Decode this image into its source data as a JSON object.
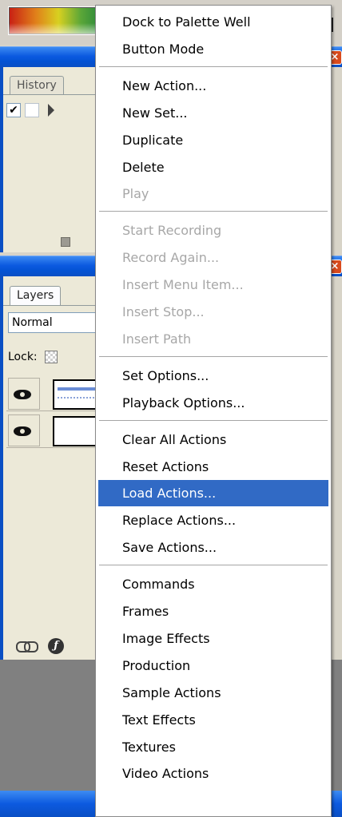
{
  "background": {
    "history_panel": {
      "tab_label": "History",
      "check_mark": "✔"
    },
    "layers_panel": {
      "tab_label": "Layers",
      "blend_mode": "Normal",
      "lock_label": "Lock:"
    },
    "icons": [
      "link-icon",
      "fx-icon",
      "eye-icon",
      "close-icon",
      "stop-icon"
    ],
    "accent_colors": {
      "titlebar": "#0a4fc4",
      "highlight": "#316ac5",
      "close_button": "#d84b1e"
    }
  },
  "menu": {
    "groups": [
      {
        "items": [
          {
            "label": "Dock to Palette Well",
            "enabled": true
          },
          {
            "label": "Button Mode",
            "enabled": true
          }
        ]
      },
      {
        "items": [
          {
            "label": "New Action...",
            "enabled": true
          },
          {
            "label": "New Set...",
            "enabled": true
          },
          {
            "label": "Duplicate",
            "enabled": true
          },
          {
            "label": "Delete",
            "enabled": true
          },
          {
            "label": "Play",
            "enabled": false
          }
        ]
      },
      {
        "items": [
          {
            "label": "Start Recording",
            "enabled": false
          },
          {
            "label": "Record Again...",
            "enabled": false
          },
          {
            "label": "Insert Menu Item...",
            "enabled": false
          },
          {
            "label": "Insert Stop...",
            "enabled": false
          },
          {
            "label": "Insert Path",
            "enabled": false
          }
        ]
      },
      {
        "items": [
          {
            "label": "Set Options...",
            "enabled": true
          },
          {
            "label": "Playback Options...",
            "enabled": true
          }
        ]
      },
      {
        "items": [
          {
            "label": "Clear All Actions",
            "enabled": true
          },
          {
            "label": "Reset Actions",
            "enabled": true
          },
          {
            "label": "Load Actions...",
            "enabled": true,
            "highlighted": true
          },
          {
            "label": "Replace Actions...",
            "enabled": true
          },
          {
            "label": "Save Actions...",
            "enabled": true
          }
        ]
      },
      {
        "items": [
          {
            "label": "Commands",
            "enabled": true
          },
          {
            "label": "Frames",
            "enabled": true
          },
          {
            "label": "Image Effects",
            "enabled": true
          },
          {
            "label": "Production",
            "enabled": true
          },
          {
            "label": "Sample Actions",
            "enabled": true
          },
          {
            "label": "Text Effects",
            "enabled": true
          },
          {
            "label": "Textures",
            "enabled": true
          },
          {
            "label": "Video Actions",
            "enabled": true
          }
        ]
      }
    ]
  }
}
